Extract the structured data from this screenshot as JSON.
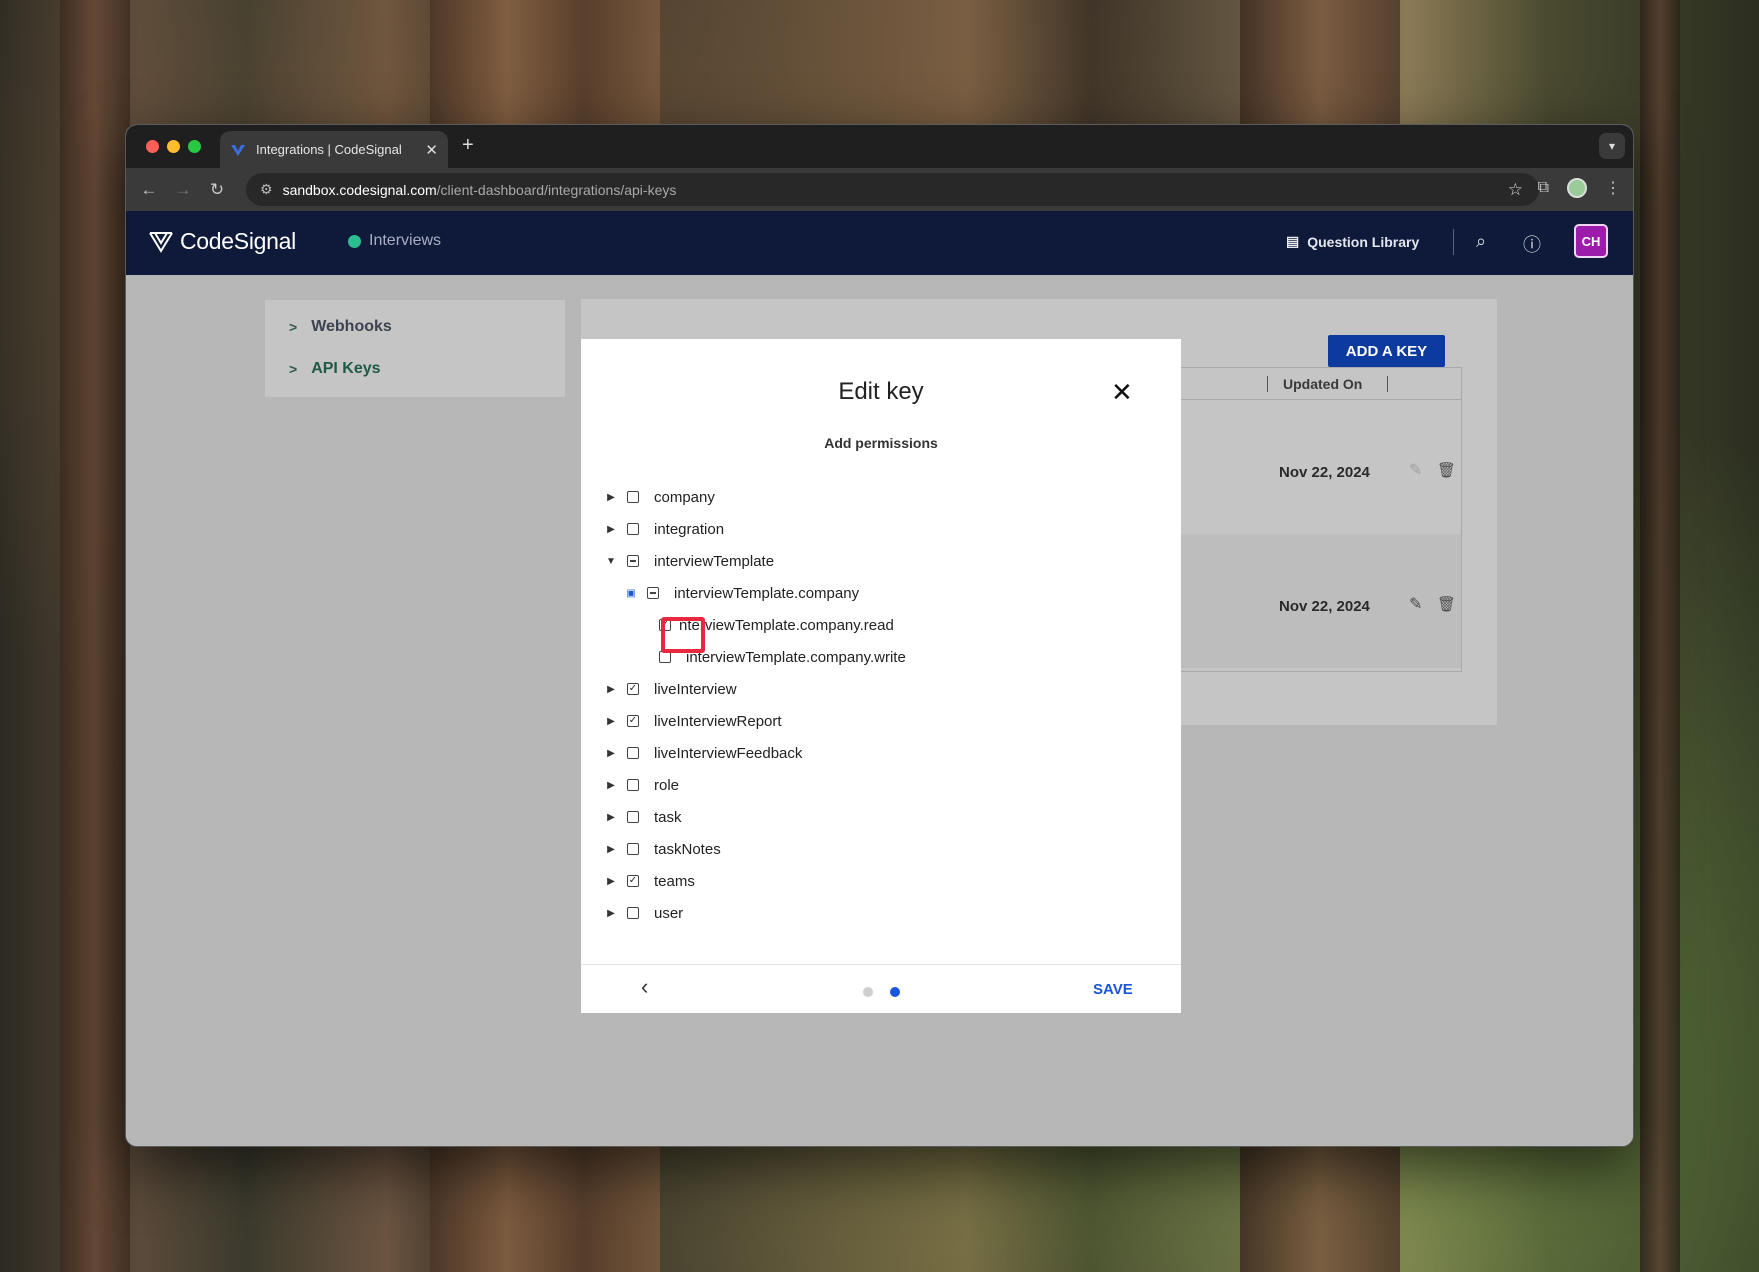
{
  "browser": {
    "tab_title": "Integrations | CodeSignal",
    "new_tab_symbol": "+",
    "url_host": "sandbox.codesignal.com",
    "url_path": "/client-dashboard/integrations/api-keys"
  },
  "app": {
    "logo_text": "CodeSignal",
    "nav_interviews": "Interviews",
    "question_library": "Question Library",
    "avatar_initials": "CH",
    "colors": {
      "header_bg": "#0f1a3a",
      "avatar": "#9c1bab",
      "accent": "#1a56db"
    }
  },
  "sidebar": {
    "items": [
      {
        "label": "Webhooks",
        "chevron": ">"
      },
      {
        "label": "API Keys",
        "chevron": ">"
      }
    ]
  },
  "main": {
    "add_key_label": "ADD A KEY",
    "column_header": "Updated On",
    "rows": [
      {
        "updated_on": "Nov 22, 2024"
      },
      {
        "updated_on": "Nov 22, 2024"
      }
    ]
  },
  "modal": {
    "title": "Edit key",
    "subtitle": "Add permissions",
    "close_symbol": "✕",
    "tree": [
      {
        "label": "company",
        "state": "unchecked",
        "expanded": false
      },
      {
        "label": "integration",
        "state": "unchecked",
        "expanded": false
      },
      {
        "label": "interviewTemplate",
        "state": "partial",
        "expanded": true
      },
      {
        "label": "interviewTemplate.company",
        "state": "partial",
        "expanded": true
      },
      {
        "label": "interviewTemplate.company.read",
        "state": "checked",
        "display": "nterviewTemplate.company.read"
      },
      {
        "label": "interviewTemplate.company.write",
        "state": "unchecked"
      },
      {
        "label": "liveInterview",
        "state": "checked",
        "expanded": false
      },
      {
        "label": "liveInterviewReport",
        "state": "checked",
        "expanded": false
      },
      {
        "label": "liveInterviewFeedback",
        "state": "unchecked",
        "expanded": false
      },
      {
        "label": "role",
        "state": "unchecked",
        "expanded": false
      },
      {
        "label": "task",
        "state": "unchecked",
        "expanded": false
      },
      {
        "label": "taskNotes",
        "state": "unchecked",
        "expanded": false
      },
      {
        "label": "teams",
        "state": "checked",
        "expanded": false
      },
      {
        "label": "user",
        "state": "unchecked",
        "expanded": false
      }
    ],
    "footer": {
      "back_symbol": "‹",
      "pagination": {
        "current": 2,
        "total": 2
      },
      "save_label": "SAVE"
    }
  }
}
